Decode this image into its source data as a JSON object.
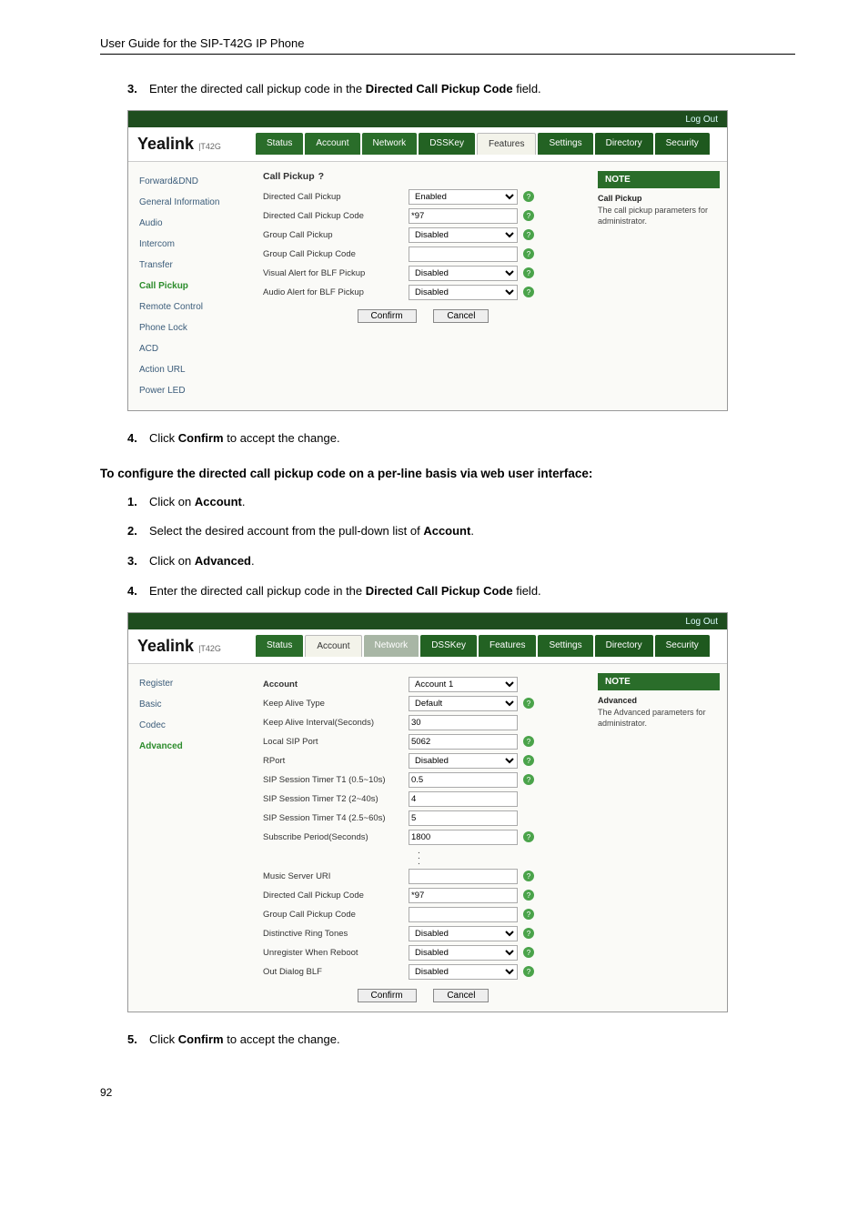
{
  "doc": {
    "header": "User Guide for the SIP-T42G IP Phone",
    "page_number": "92"
  },
  "steps_top": {
    "num3": "3.",
    "txt3a": "Enter the directed call pickup code in the ",
    "txt3b": "Directed Call Pickup Code",
    "txt3c": " field."
  },
  "steps_mid": {
    "num4": "4.",
    "txt4a": "Click ",
    "txt4b": "Confirm",
    "txt4c": " to accept the change."
  },
  "subhead": "To configure the directed call pickup code on a per-line basis via web user interface:",
  "steps_lower": [
    {
      "num": "1.",
      "pre": "Click on ",
      "bold": "Account",
      "post": "."
    },
    {
      "num": "2.",
      "pre": "Select the desired account from the pull-down list of ",
      "bold": "Account",
      "post": "."
    },
    {
      "num": "3.",
      "pre": "Click on ",
      "bold": "Advanced",
      "post": "."
    },
    {
      "num": "4.",
      "pre": "Enter the directed call pickup code in the ",
      "bold": "Directed Call Pickup Code",
      "post": " field."
    }
  ],
  "steps_bottom": {
    "num5": "5.",
    "txt5a": "Click ",
    "txt5b": "Confirm",
    "txt5c": " to accept the change."
  },
  "shot_common": {
    "logout": "Log Out",
    "logo": "Yealink",
    "logo_sub": "T42G",
    "tabs": [
      "Status",
      "Account",
      "Network",
      "DSSKey",
      "Features",
      "Settings",
      "Directory",
      "Security"
    ],
    "confirm": "Confirm",
    "cancel": "Cancel",
    "note_title": "NOTE"
  },
  "shot1": {
    "active_tab": "Features",
    "side": [
      "Forward&DND",
      "General Information",
      "Audio",
      "Intercom",
      "Transfer",
      "Call Pickup",
      "Remote Control",
      "Phone Lock",
      "ACD",
      "Action URL",
      "Power LED"
    ],
    "side_active": "Call Pickup",
    "section": "Call Pickup",
    "rows": [
      {
        "label": "Directed Call Pickup",
        "type": "select",
        "value": "Enabled",
        "help": true
      },
      {
        "label": "Directed Call Pickup Code",
        "type": "text",
        "value": "*97",
        "help": true
      },
      {
        "label": "Group Call Pickup",
        "type": "select",
        "value": "Disabled",
        "help": true
      },
      {
        "label": "Group Call Pickup Code",
        "type": "text",
        "value": "",
        "help": true
      },
      {
        "label": "Visual Alert for BLF Pickup",
        "type": "select",
        "value": "Disabled",
        "help": true
      },
      {
        "label": "Audio Alert for BLF Pickup",
        "type": "select",
        "value": "Disabled",
        "help": true
      }
    ],
    "note_heading": "Call Pickup",
    "note_body": "The call pickup parameters for administrator."
  },
  "shot2": {
    "active_tab": "Account",
    "side": [
      "Register",
      "Basic",
      "Codec",
      "Advanced"
    ],
    "side_active": "Advanced",
    "section": "Account",
    "account_value": "Account 1",
    "rows_top": [
      {
        "label": "Keep Alive Type",
        "type": "select",
        "value": "Default",
        "help": true
      },
      {
        "label": "Keep Alive Interval(Seconds)",
        "type": "text",
        "value": "30",
        "help": false
      },
      {
        "label": "Local SIP Port",
        "type": "text",
        "value": "5062",
        "help": true
      },
      {
        "label": "RPort",
        "type": "select",
        "value": "Disabled",
        "help": true
      },
      {
        "label": "SIP Session Timer T1 (0.5~10s)",
        "type": "text",
        "value": "0.5",
        "help": true
      },
      {
        "label": "SIP Session Timer T2 (2~40s)",
        "type": "text",
        "value": "4",
        "help": false
      },
      {
        "label": "SIP Session Timer T4 (2.5~60s)",
        "type": "text",
        "value": "5",
        "help": false
      },
      {
        "label": "Subscribe Period(Seconds)",
        "type": "text",
        "value": "1800",
        "help": true
      }
    ],
    "rows_bottom": [
      {
        "label": "Music Server URI",
        "type": "text",
        "value": "",
        "help": true
      },
      {
        "label": "Directed Call Pickup Code",
        "type": "text",
        "value": "*97",
        "help": true
      },
      {
        "label": "Group Call Pickup Code",
        "type": "text",
        "value": "",
        "help": true
      },
      {
        "label": "Distinctive Ring Tones",
        "type": "select",
        "value": "Disabled",
        "help": true
      },
      {
        "label": "Unregister When Reboot",
        "type": "select",
        "value": "Disabled",
        "help": true
      },
      {
        "label": "Out Dialog BLF",
        "type": "select",
        "value": "Disabled",
        "help": true
      }
    ],
    "note_heading": "Advanced",
    "note_body": "The Advanced parameters for administrator."
  }
}
